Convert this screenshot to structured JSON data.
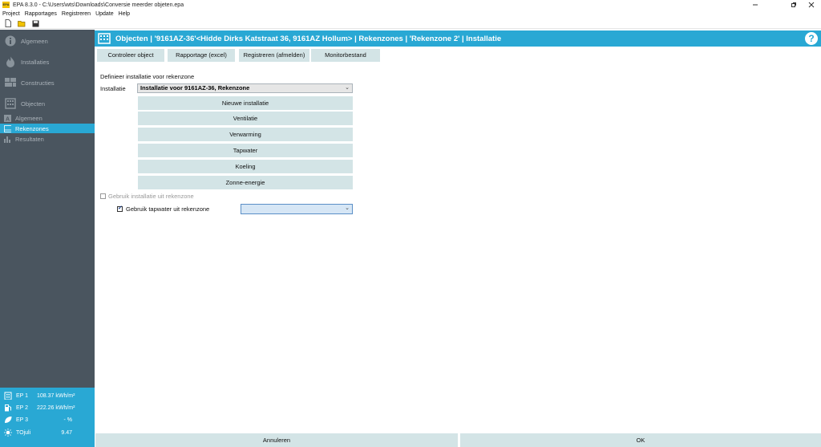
{
  "window": {
    "app_icon_text": "EPA",
    "title": "EPA 8.3.0 - C:\\Users\\wts\\Downloads\\Conversie meerder objeten.epa"
  },
  "menu": [
    "Project",
    "Rapportages",
    "Registreren",
    "Update",
    "Help"
  ],
  "sidebar": {
    "main_items": [
      {
        "label": "Algemeen",
        "icon": "info-icon"
      },
      {
        "label": "Installaties",
        "icon": "flame-icon"
      },
      {
        "label": "Constructies",
        "icon": "bricks-icon"
      },
      {
        "label": "Objecten",
        "icon": "building-icon"
      }
    ],
    "sub_items": [
      {
        "label": "Algemeen",
        "icon": "letter-a-icon"
      },
      {
        "label": "Rekenzones",
        "icon": "zones-icon",
        "active": true
      },
      {
        "label": "Resultaten",
        "icon": "barchart-icon"
      }
    ],
    "indicators": [
      {
        "name": "EP 1",
        "value": "108.37 kWh/m²",
        "icon": "building-icon"
      },
      {
        "name": "EP 2",
        "value": "222.26 kWh/m²",
        "icon": "fuel-icon"
      },
      {
        "name": "EP 3",
        "value": "- %",
        "icon": "leaf-icon"
      },
      {
        "name": "TOjuli",
        "value": "9.47",
        "icon": "sun-icon"
      }
    ]
  },
  "header": {
    "title": "Objecten | '9161AZ-36'<Hidde Dirks Katstraat 36, 9161AZ Hollum> | Rekenzones | 'Rekenzone 2' | Installatie",
    "help": "?"
  },
  "actions": [
    "Controleer object",
    "Rapportage (excel)",
    "Registreren (afmelden)",
    "Monitorbestand"
  ],
  "form": {
    "section_title": "Definieer installatie voor rekenzone",
    "installatie_label": "Installatie",
    "installatie_value": "Installatie voor 9161AZ-36, Rekenzone",
    "buttons": [
      "Nieuwe installatie",
      "Ventilatie",
      "Verwarming",
      "Tapwater",
      "Koeling",
      "Zonne-energie"
    ],
    "checkbox_installatie": {
      "label": "Gebruik installatie uit rekenzone",
      "checked": false
    },
    "checkbox_tapwater": {
      "label": "Gebruik tapwater uit rekenzone",
      "checked": true
    },
    "tapwater_select_value": ""
  },
  "footer": {
    "cancel": "Annuleren",
    "ok": "OK"
  },
  "colors": {
    "accent": "#29a8d4",
    "sidebar": "#4a555f",
    "button": "#d3e4e6"
  }
}
